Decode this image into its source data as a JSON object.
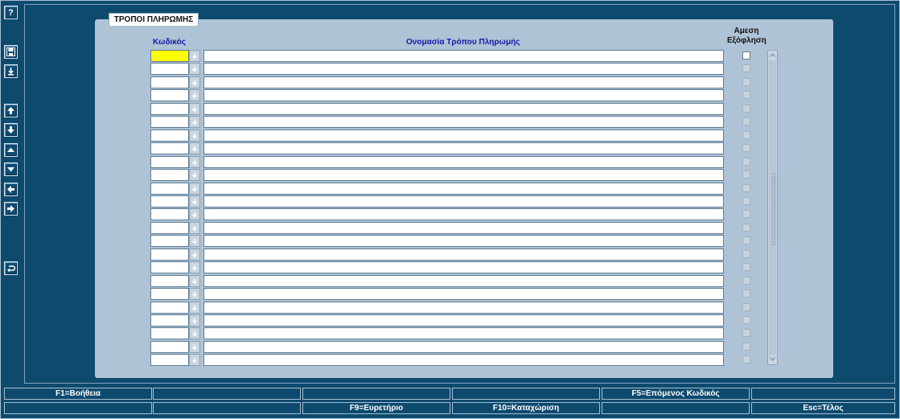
{
  "panel": {
    "tab_title": "ΤΡΟΠΟΙ ΠΛΗΡΩΜΗΣ",
    "columns": {
      "code": "Κωδικός",
      "name": "Ονομασία Τρόπου Πληρωμής",
      "immediate_line1": "Αμεση",
      "immediate_line2": "Εξόφληση"
    },
    "row_count": 24,
    "active_row": 0
  },
  "toolbar": {
    "buttons": [
      {
        "name": "help-button",
        "icon": "question-icon"
      },
      {
        "name": "save-button",
        "icon": "save-disk-icon"
      },
      {
        "name": "download-button",
        "icon": "arrow-down-bar-icon"
      },
      {
        "name": "first-record-button",
        "icon": "arrow-up-icon"
      },
      {
        "name": "last-record-button",
        "icon": "arrow-down-icon"
      },
      {
        "name": "previous-record-button",
        "icon": "triangle-up-icon"
      },
      {
        "name": "next-record-button",
        "icon": "triangle-down-icon"
      },
      {
        "name": "previous-block-button",
        "icon": "arrow-left-icon"
      },
      {
        "name": "next-block-button",
        "icon": "arrow-right-icon"
      },
      {
        "name": "undo-button",
        "icon": "return-icon"
      }
    ]
  },
  "function_keys": {
    "row1": [
      "F1=Βοήθεια",
      "",
      "",
      "",
      "F5=Επόμενος Κωδικός",
      ""
    ],
    "row2": [
      "",
      "",
      "F9=Ευρετήριο",
      "F10=Καταχώριση",
      "",
      "Esc=Τέλος"
    ]
  },
  "colors": {
    "background": "#0e4a6e",
    "panel": "#aec3d6",
    "active_field": "#ffff00",
    "header_text": "#1a18a8"
  }
}
